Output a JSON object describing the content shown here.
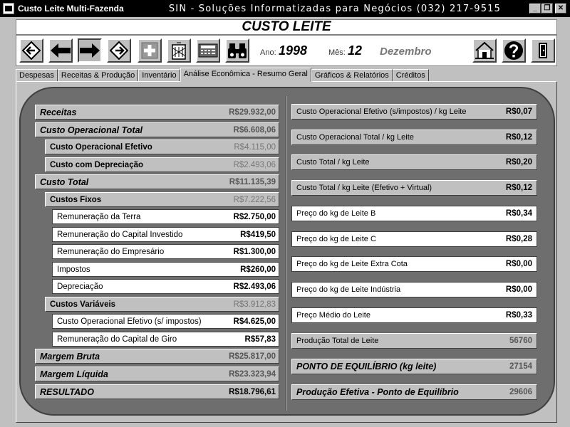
{
  "window": {
    "app_title": "Custo Leite Multi-Fazenda",
    "company": "SIN - Soluções Informatizadas para Negócios (032) 217-9515",
    "buttons": [
      "_",
      "❐",
      "✕"
    ]
  },
  "header": {
    "title": "CUSTO LEITE"
  },
  "toolbar": {
    "ano_label": "Ano:",
    "ano_value": "1998",
    "mes_label": "Mês:",
    "mes_value": "12",
    "mes_name": "Dezembro"
  },
  "tabs": [
    {
      "label": "Despesas"
    },
    {
      "label": "Receitas & Produção"
    },
    {
      "label": "Inventário"
    },
    {
      "label": "Análise Econômica - Resumo Geral"
    },
    {
      "label": "Gráficos & Relatórios"
    },
    {
      "label": "Créditos"
    }
  ],
  "left": [
    {
      "label": "Receitas",
      "value": "R$29.932,00"
    },
    {
      "label": "Custo Operacional Total",
      "value": "R$6.608,06"
    },
    {
      "label": "Custo Operacional Efetivo",
      "value": "R$4.115,00"
    },
    {
      "label": "Custo com Depreciação",
      "value": "R$2.493,06"
    },
    {
      "label": "Custo Total",
      "value": "R$11.135,39"
    },
    {
      "label": "Custos Fixos",
      "value": "R$7.222,56"
    },
    {
      "label": "Remuneração da Terra",
      "value": "R$2.750,00"
    },
    {
      "label": "Remuneração do Capital Investido",
      "value": "R$419,50"
    },
    {
      "label": "Remuneração do Empresário",
      "value": "R$1.300,00"
    },
    {
      "label": "Impostos",
      "value": "R$260,00"
    },
    {
      "label": "Depreciação",
      "value": "R$2.493,06"
    },
    {
      "label": "Custos Variáveis",
      "value": "R$3.912,83"
    },
    {
      "label": "Custo Operacional Efetivo (s/ impostos)",
      "value": "R$4.625,00"
    },
    {
      "label": "Remuneração do Capital de Giro",
      "value": "R$57,83"
    },
    {
      "label": "Margem Bruta",
      "value": "R$25.817,00"
    },
    {
      "label": "Margem Líquida",
      "value": "R$23.323,94"
    },
    {
      "label": "RESULTADO",
      "value": "R$18.796,61"
    }
  ],
  "right": [
    {
      "label": "Custo Operacional Efetivo (s/impostos) / kg Leite",
      "value": "R$0,07"
    },
    {
      "label": "Custo Operacional Total / kg Leite",
      "value": "R$0,12"
    },
    {
      "label": "Custo Total / kg Leite",
      "value": "R$0,20"
    },
    {
      "label": "Custo Total / kg Leite (Efetivo + Virtual)",
      "value": "R$0,12"
    },
    {
      "label": "Preço do kg de Leite B",
      "value": "R$0,34"
    },
    {
      "label": "Preço do kg de Leite C",
      "value": "R$0,28"
    },
    {
      "label": "Preço do kg de Leite Extra Cota",
      "value": "R$0,00"
    },
    {
      "label": "Preço do kg de Leite Indústria",
      "value": "R$0,00"
    },
    {
      "label": "Preço Médio do Leite",
      "value": "R$0,33"
    },
    {
      "label": "Produção Total de Leite",
      "value": "56760"
    },
    {
      "label": "PONTO DE EQUILÍBRIO (kg leite)",
      "value": "27154"
    },
    {
      "label": "Produção Efetiva - Ponto de Equilíbrio",
      "value": "29606"
    }
  ]
}
